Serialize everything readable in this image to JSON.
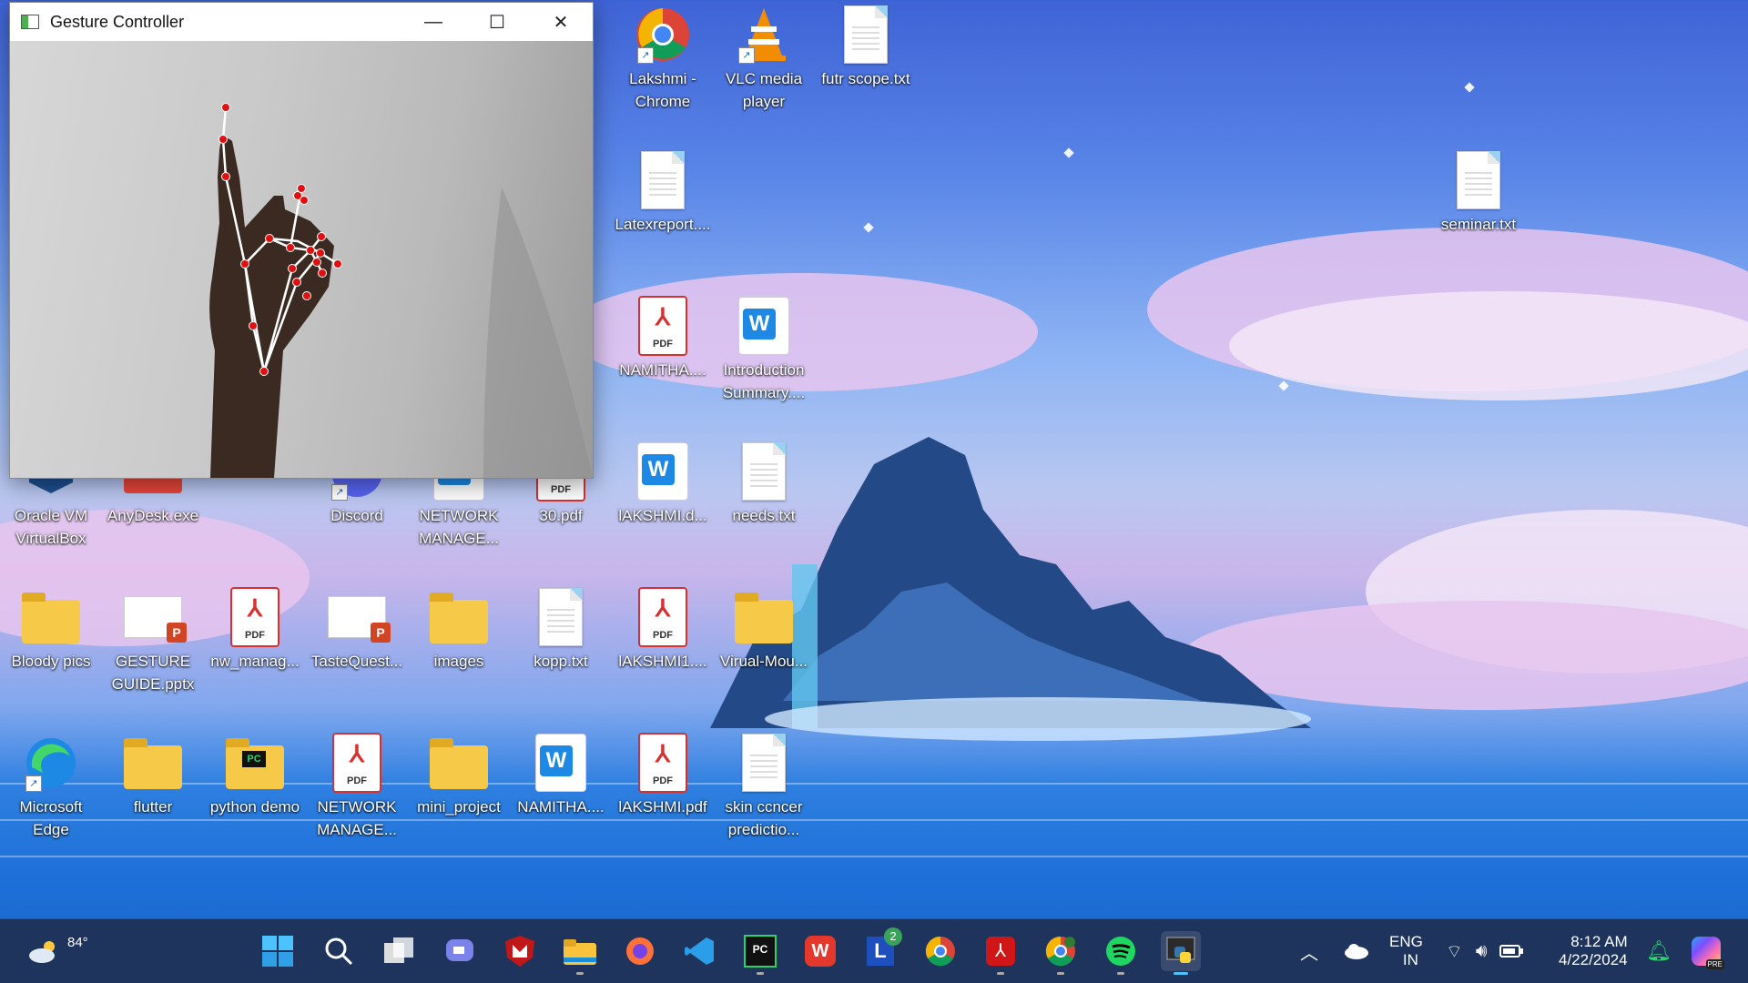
{
  "window": {
    "title": "Gesture Controller",
    "controls": [
      "minimize",
      "maximize",
      "close"
    ]
  },
  "desktop_icons": {
    "chrome": "Lakshmi - Chrome",
    "vlc": "VLC media player",
    "futr": "futr scope.txt",
    "latex": "Latexreport....",
    "seminar": "seminar.txt",
    "namitha_pdf": "NAMITHA....",
    "intro": "Introduction Summary....",
    "oracle": "Oracle VM VirtualBox",
    "anydesk": "AnyDesk.exe",
    "discord": "Discord",
    "network1": "NETWORK MANAGE...",
    "pdf30": "30.pdf",
    "lakshmi_doc": "lAKSHMI.d...",
    "needs": "needs.txt",
    "bloody": "Bloody pics",
    "gesture_guide": "GESTURE GUIDE.pptx",
    "nw_manag": "nw_manag...",
    "tastequest": "TasteQuest...",
    "images": "images",
    "kopp": "kopp.txt",
    "lakshmi1": "lAKSHMI1....",
    "virual": "Virual-Mou...",
    "edge": "Microsoft Edge",
    "flutter": "flutter",
    "python_demo": "python demo",
    "network2": "NETWORK MANAGE...",
    "mini_project": "mini_project",
    "namitha_doc": "NAMITHA....",
    "lakshmi_pdf": "lAKSHMI.pdf",
    "skin": "skin ccncer predictio..."
  },
  "taskbar": {
    "weather_temp": "84°",
    "lang": "ENG",
    "region": "IN",
    "time": "8:12 AM",
    "date": "4/22/2024",
    "badge_l": "2",
    "copilot_badge": "PRE",
    "apps": [
      "start",
      "search",
      "task-view",
      "teams",
      "mcafee",
      "file-explorer",
      "firefox",
      "vscode",
      "pycharm",
      "wps",
      "l-app",
      "chrome",
      "acrobat",
      "chrome-profile",
      "spotify",
      "python"
    ]
  },
  "icon_tags": {
    "pdf": "PDF",
    "word": "W",
    "ppt": "P",
    "pc": "PC"
  }
}
